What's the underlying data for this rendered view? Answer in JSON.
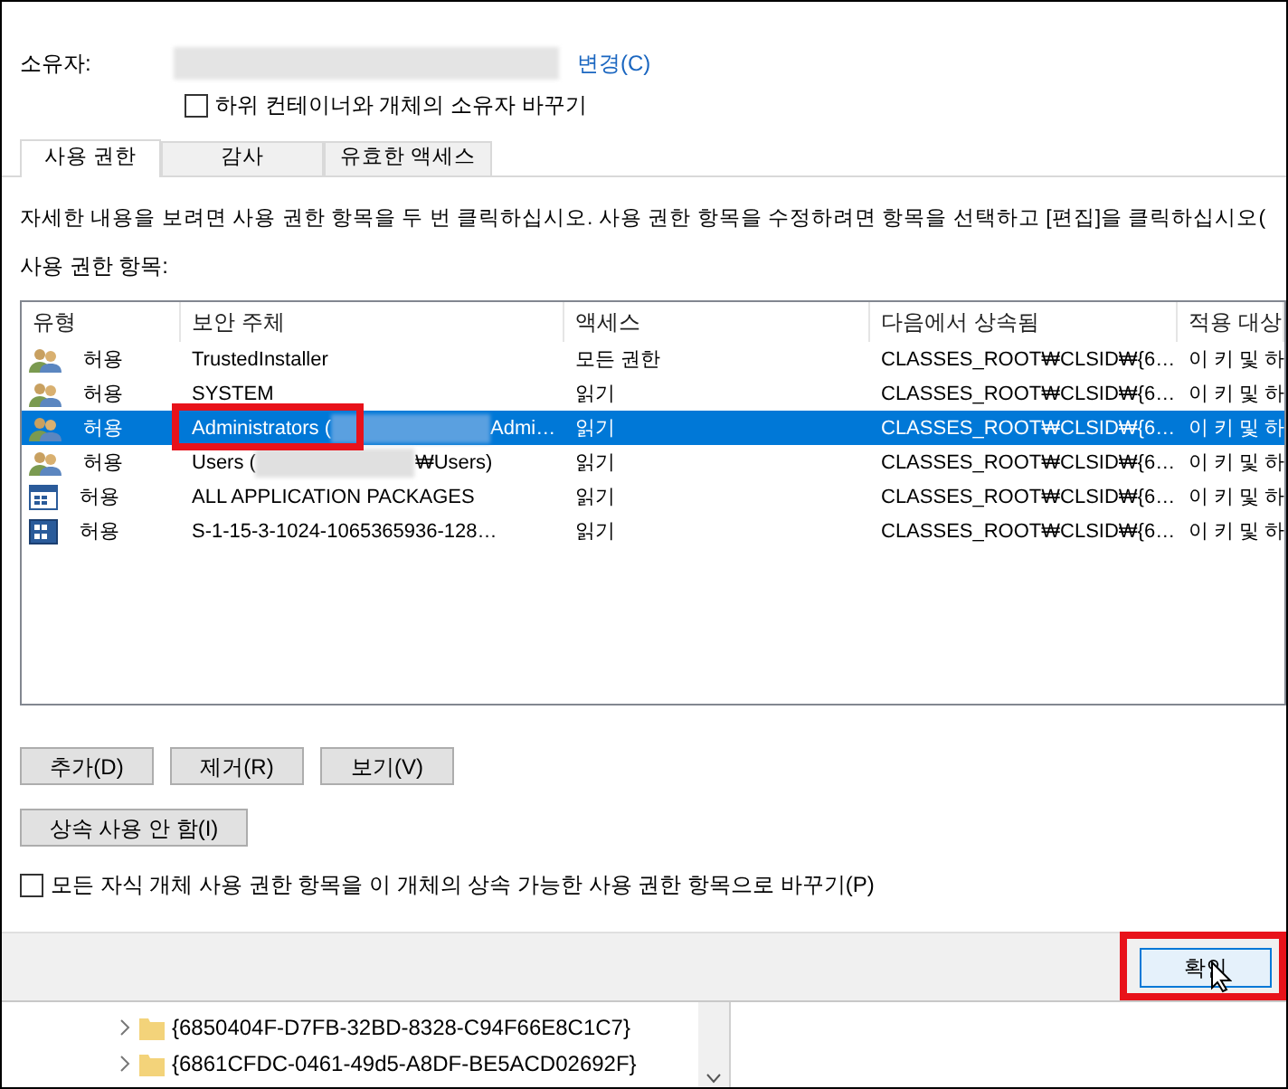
{
  "owner": {
    "label": "소유자:",
    "change_link": "변경(C)"
  },
  "replace_owner": {
    "label": "하위 컨테이너와 개체의 소유자 바꾸기",
    "checked": false
  },
  "tabs": [
    {
      "label": "사용 권한",
      "selected": true
    },
    {
      "label": "감사",
      "selected": false
    },
    {
      "label": "유효한 액세스",
      "selected": false
    }
  ],
  "description": "자세한 내용을 보려면 사용 권한 항목을 두 번 클릭하십시오. 사용 권한 항목을 수정하려면 항목을 선택하고 [편집]을 클릭하십시오(",
  "list_label": "사용 권한 항목:",
  "table": {
    "columns": [
      "유형",
      "보안 주체",
      "액세스",
      "다음에서 상속됨",
      "적용 대상"
    ],
    "rows": [
      {
        "kind": "user",
        "type": "허용",
        "principal": [
          "TrustedInstaller"
        ],
        "access": "모든 권한",
        "inherited": "CLASSES_ROOT₩CLSID₩{6…",
        "applies": "이 키 및 하",
        "selected": false
      },
      {
        "kind": "user",
        "type": "허용",
        "principal": [
          "SYSTEM"
        ],
        "access": "읽기",
        "inherited": "CLASSES_ROOT₩CLSID₩{6…",
        "applies": "이 키 및 하",
        "selected": false
      },
      {
        "kind": "user",
        "type": "허용",
        "principal": [
          "Administrators (",
          "Admi…"
        ],
        "access": "읽기",
        "inherited": "CLASSES_ROOT₩CLSID₩{6…",
        "applies": "이 키 및 하",
        "selected": true
      },
      {
        "kind": "user",
        "type": "허용",
        "principal": [
          "Users (",
          "₩Users)"
        ],
        "access": "읽기",
        "inherited": "CLASSES_ROOT₩CLSID₩{6…",
        "applies": "이 키 및 하",
        "selected": false
      },
      {
        "kind": "package",
        "type": "허용",
        "principal": [
          "ALL APPLICATION PACKAGES"
        ],
        "access": "읽기",
        "inherited": "CLASSES_ROOT₩CLSID₩{6…",
        "applies": "이 키 및 하",
        "selected": false
      },
      {
        "kind": "app",
        "type": "허용",
        "principal": [
          "S-1-15-3-1024-1065365936-128…"
        ],
        "access": "읽기",
        "inherited": "CLASSES_ROOT₩CLSID₩{6…",
        "applies": "이 키 및 하",
        "selected": false
      }
    ]
  },
  "buttons": [
    "추가(D)",
    "제거(R)",
    "보기(V)"
  ],
  "disable_inheritance": "상속 사용 안 함(I)",
  "replace_children": {
    "label": "모든 자식 개체 사용 권한 항목을 이 개체의 상속 가능한 사용 권한 항목으로 바꾸기(P)",
    "checked": false
  },
  "ok_button": "확인",
  "background_tree": [
    "{6850404F-D7FB-32BD-8328-C94F66E8C1C7}",
    "{6861CFDC-0461-49d5-A8DF-BE5ACD02692F}"
  ]
}
